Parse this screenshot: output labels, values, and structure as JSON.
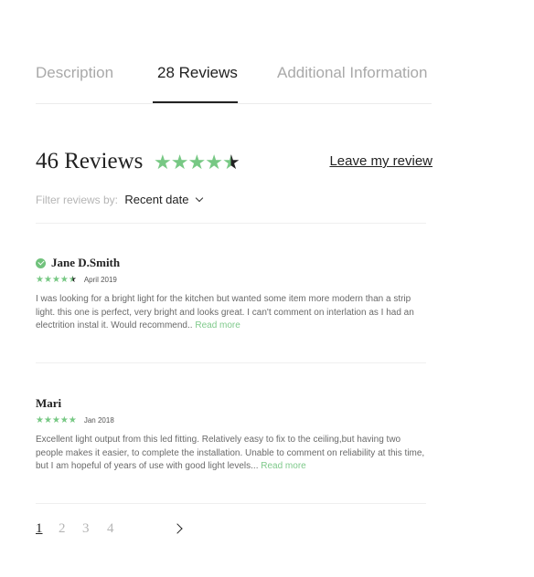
{
  "tabs": [
    {
      "label": "Description"
    },
    {
      "label": "28 Reviews"
    },
    {
      "label": "Additional Information"
    }
  ],
  "summary": {
    "title": "46 Reviews",
    "rating": 4.5,
    "max_rating": 5,
    "leave_review": "Leave my review"
  },
  "filter": {
    "label": "Filter reviews by:",
    "selected": "Recent date"
  },
  "reviews": [
    {
      "name": "Jane D.Smith",
      "verified": true,
      "rating": 4.5,
      "date": "April 2019",
      "text": "I was looking for a bright light for the kitchen but wanted some item more modern than a strip light. this one is perfect, very bright and looks great. I can't comment on interlation as I had an electrition instal it. Would recommend.. ",
      "read_more": "Read more"
    },
    {
      "name": "Mari",
      "verified": false,
      "rating": 5,
      "date": "Jan 2018",
      "text": "Excellent light output from this led fitting. Relatively easy to fix to the ceiling,but having two people makes it easier, to complete the installation. Unable to comment on reliability at this time, but I am hopeful of years of use with good light levels... ",
      "read_more": "Read more"
    }
  ],
  "pagination": {
    "pages": [
      "1",
      "2",
      "3",
      "4"
    ],
    "current": "1"
  },
  "colors": {
    "accent_green": "#77c884",
    "text_dark": "#222222",
    "text_muted": "#a9a9a9"
  },
  "icons": {
    "star": "star-icon",
    "verified": "verified-check-icon",
    "dropdown": "chevron-down-icon",
    "next": "chevron-right-icon"
  }
}
